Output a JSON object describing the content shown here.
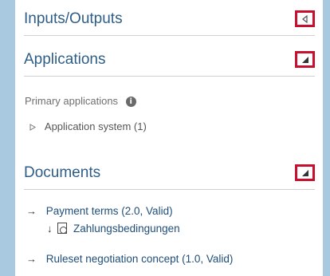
{
  "sections": {
    "inputs_outputs": {
      "title": "Inputs/Outputs",
      "toggle_icon": "triangle-left"
    },
    "applications": {
      "title": "Applications",
      "toggle_icon": "triangle-bottom-right",
      "primary_label": "Primary applications",
      "items": [
        {
          "label": "Application system (1)"
        }
      ]
    },
    "documents": {
      "title": "Documents",
      "toggle_icon": "triangle-bottom-right",
      "items": [
        {
          "label": "Payment terms (2.0, Valid)",
          "sub_label": "Zahlungsbedingungen"
        },
        {
          "label": "Ruleset negotiation concept (1.0, Valid)"
        }
      ]
    }
  },
  "colors": {
    "accent": "#2e5e87",
    "highlight_border": "#c8102e",
    "background": "#a9c9e0"
  }
}
